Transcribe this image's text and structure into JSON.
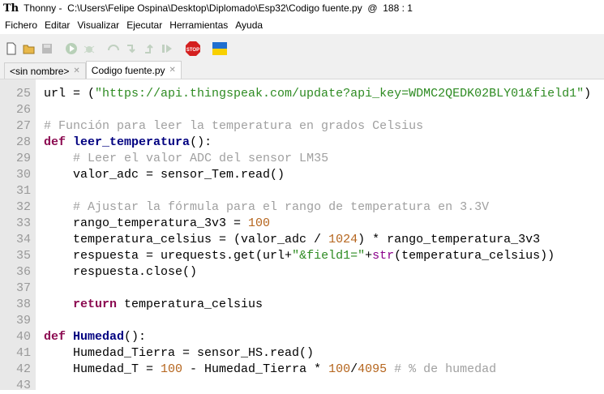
{
  "title": {
    "app": "Thonny",
    "path": "C:\\Users\\Felipe Ospina\\Desktop\\Diplomado\\Esp32\\Codigo fuente.py",
    "position": "188 : 1"
  },
  "menu": [
    "Fichero",
    "Editar",
    "Visualizar",
    "Ejecutar",
    "Herramientas",
    "Ayuda"
  ],
  "toolbar": {
    "stop_label": "STOP"
  },
  "tabs": [
    {
      "label": "<sin nombre>"
    },
    {
      "label": "Codigo fuente.py"
    }
  ],
  "colors": {
    "string": "#2e8b22",
    "comment": "#a0a0a0",
    "keyword": "#8b0a50",
    "function": "#000080",
    "number": "#b5651d"
  },
  "editor": {
    "line_numbers": [
      "25",
      "26",
      "27",
      "28",
      "29",
      "30",
      "31",
      "32",
      "33",
      "34",
      "35",
      "36",
      "37",
      "38",
      "39",
      "40",
      "41",
      "42",
      "43"
    ],
    "lines": [
      [
        [
          "",
          "url = ("
        ],
        [
          "str",
          "\"https://api.thingspeak.com/update?api_key=WDMC2QEDK02BLY01&field1\""
        ],
        [
          "",
          ")"
        ]
      ],
      [],
      [
        [
          "com",
          "# Función para leer la temperatura en grados Celsius"
        ]
      ],
      [
        [
          "kw",
          "def"
        ],
        [
          "",
          "",
          " "
        ],
        [
          "fn",
          "leer_temperatura"
        ],
        [
          "",
          "():"
        ]
      ],
      [
        [
          "",
          "    "
        ],
        [
          "com",
          "# Leer el valor ADC del sensor LM35"
        ]
      ],
      [
        [
          "",
          "    valor_adc = sensor_Tem.read()"
        ]
      ],
      [],
      [
        [
          "",
          "    "
        ],
        [
          "com",
          "# Ajustar la fórmula para el rango de temperatura en 3.3V"
        ]
      ],
      [
        [
          "",
          "    rango_temperatura_3v3 = "
        ],
        [
          "num",
          "100"
        ]
      ],
      [
        [
          "",
          "    temperatura_celsius = (valor_adc / "
        ],
        [
          "num",
          "1024"
        ],
        [
          "",
          ") * rango_temperatura_3v3"
        ]
      ],
      [
        [
          "",
          "    respuesta = urequests.get(url+"
        ],
        [
          "str",
          "\"&field1=\""
        ],
        [
          "",
          "+"
        ],
        [
          "bi",
          "str"
        ],
        [
          "",
          "(temperatura_celsius))"
        ]
      ],
      [
        [
          "",
          "    respuesta.close()"
        ]
      ],
      [],
      [
        [
          "",
          "    "
        ],
        [
          "kw",
          "return"
        ],
        [
          "",
          " temperatura_celsius"
        ]
      ],
      [],
      [
        [
          "kw",
          "def"
        ],
        [
          "",
          " "
        ],
        [
          "fn",
          "Humedad"
        ],
        [
          "",
          "():"
        ]
      ],
      [
        [
          "",
          "    Humedad_Tierra = sensor_HS.read()"
        ]
      ],
      [
        [
          "",
          "    Humedad_T = "
        ],
        [
          "num",
          "100"
        ],
        [
          "",
          " - Humedad_Tierra * "
        ],
        [
          "num",
          "100"
        ],
        [
          "",
          "/"
        ],
        [
          "num",
          "4095"
        ],
        [
          "",
          " "
        ],
        [
          "com",
          "# % de humedad"
        ]
      ],
      []
    ]
  }
}
